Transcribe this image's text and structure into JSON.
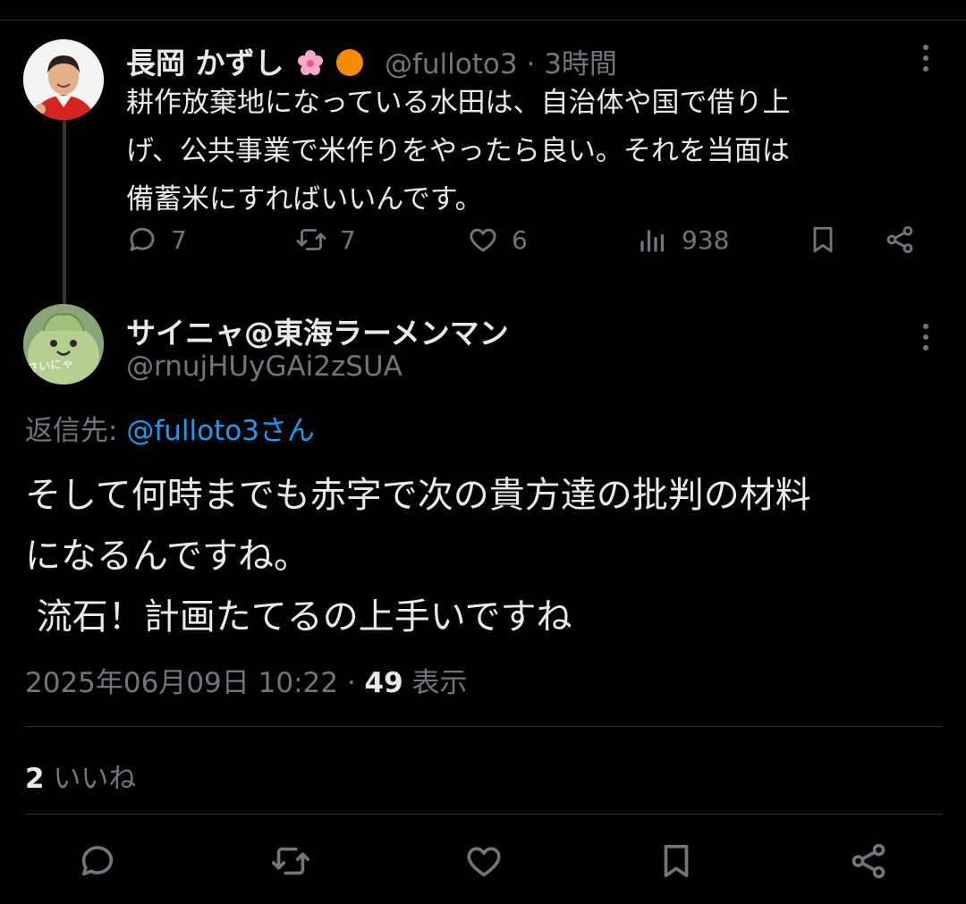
{
  "original_tweet": {
    "author_name": "長岡 かずし",
    "badge_icons": [
      "cherry-blossom-emoji",
      "orange-circle-emoji"
    ],
    "handle": "@fulloto3",
    "separator": "·",
    "time": "3時間",
    "text_lines": [
      "耕作放棄地になっている水田は、自治体や国で借り上",
      "げ、公共事業で米作りをやったら良い。それを当面は",
      "備蓄米にすればいいんです。"
    ],
    "reply_count": "7",
    "retweet_count": "7",
    "like_count": "6",
    "view_count": "938"
  },
  "reply_tweet": {
    "author_name": "サイニャ@東海ラーメンマン",
    "handle": "@rnujHUyGAi2zSUA",
    "avatar_caption": "さいにゃ",
    "reply_to_label": "返信先: ",
    "reply_to_mention": "@fulloto3さん",
    "text_lines": [
      "そして何時までも赤字で次の貴方達の批判の材料",
      "になるんですね。",
      " 流石！計画たてるの上手いですね"
    ],
    "timestamp": "2025年06月09日 10:22",
    "separator": " · ",
    "view_count": "49",
    "view_label": " 表示",
    "like_count": "2",
    "like_label": " いいね"
  },
  "icons": {
    "actions": [
      "reply-icon",
      "retweet-icon",
      "like-icon",
      "views-icon",
      "bookmark-icon",
      "share-icon"
    ],
    "more": "more-dots-icon"
  },
  "colors": {
    "background": "#000000",
    "text": "#e7e9ea",
    "muted": "#71767b",
    "link": "#1d9bf0",
    "divider": "#2f3336"
  }
}
